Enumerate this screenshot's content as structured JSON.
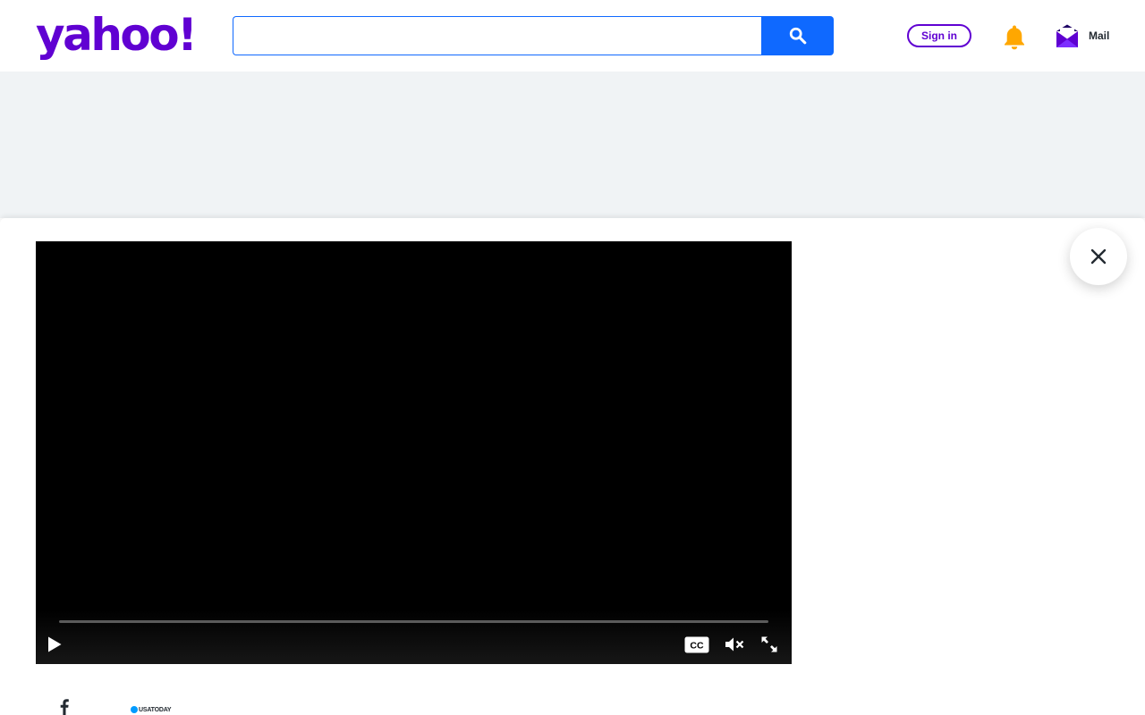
{
  "header": {
    "logo": "yahoo!",
    "search": {
      "value": "",
      "placeholder": ""
    },
    "signin_label": "Sign in",
    "mail_label": "Mail"
  },
  "video": {
    "progress": 0
  },
  "footer": {
    "source_name": "USATODAY"
  },
  "colors": {
    "brand_purple": "#6001d2",
    "search_blue": "#0f69ff",
    "bell_yellow": "#ffa700",
    "ad_gray": "#f0f3f5"
  },
  "icons": [
    "search-icon",
    "bell-icon",
    "mail-icon",
    "close-icon",
    "play-icon",
    "closed-captions-icon",
    "mute-icon",
    "fullscreen-icon",
    "facebook-icon"
  ]
}
